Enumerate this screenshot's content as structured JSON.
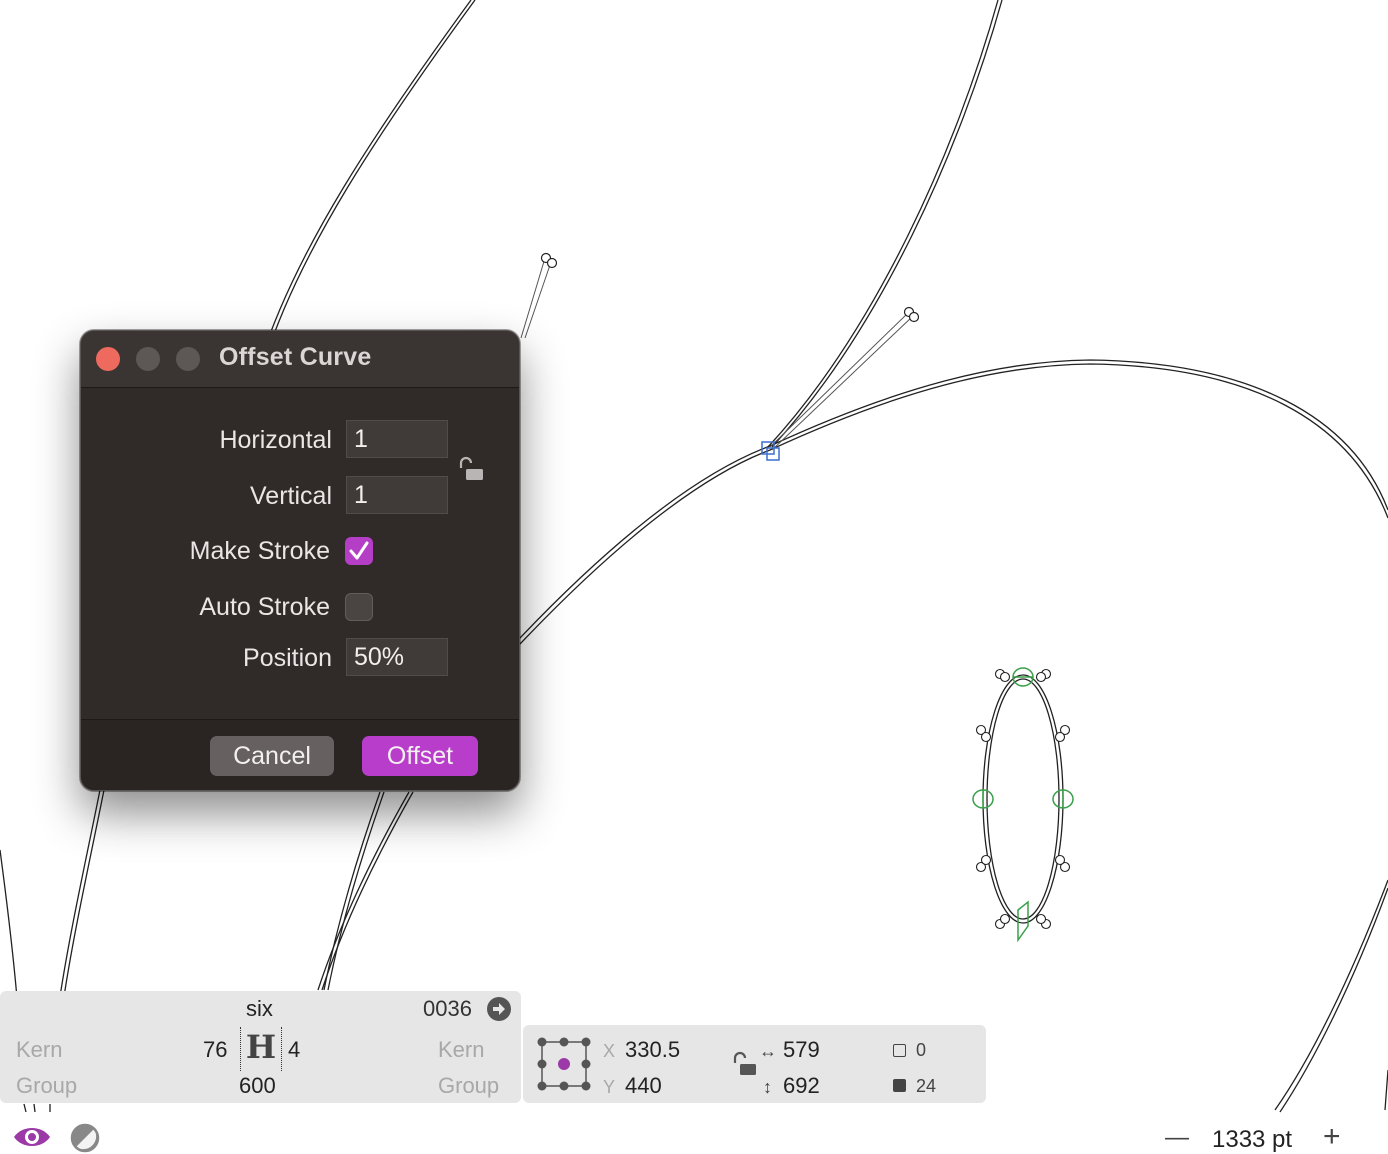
{
  "dialog": {
    "title": "Offset Curve",
    "horizontal_label": "Horizontal",
    "horizontal_value": "1",
    "vertical_label": "Vertical",
    "vertical_value": "1",
    "make_stroke_label": "Make Stroke",
    "make_stroke_checked": true,
    "auto_stroke_label": "Auto Stroke",
    "auto_stroke_checked": false,
    "position_label": "Position",
    "position_value": "50%",
    "cancel_label": "Cancel",
    "offset_label": "Offset",
    "accent_color": "#b83dca"
  },
  "glyph_info": {
    "glyph_name": "six",
    "unicode": "0036",
    "left_kern_label": "Kern",
    "left_group_label": "Group",
    "right_kern_label": "Kern",
    "right_group_label": "Group",
    "lsb": "76",
    "rsb": "4",
    "width": "600",
    "metrics_glyph": "H"
  },
  "selection_info": {
    "x_label": "X",
    "x_value": "330.5",
    "y_label": "Y",
    "y_value": "440",
    "width_value": "579",
    "height_value": "692",
    "stat_a": "0",
    "stat_b": "24"
  },
  "bottom_bar": {
    "zoom_value": "1333 pt",
    "zoom_out_label": "—",
    "zoom_in_label": "+"
  }
}
